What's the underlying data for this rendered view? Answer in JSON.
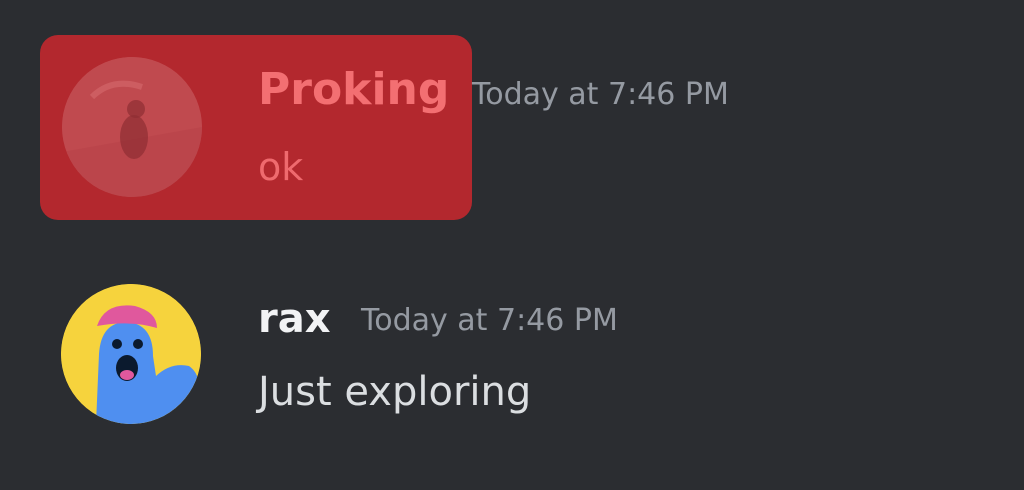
{
  "messages": [
    {
      "username": "Proking",
      "timestamp": "Today at 7:46 PM",
      "content": "ok",
      "highlighted": true,
      "avatar": "photo-avatar",
      "username_color": "#f36f72",
      "highlight_color": "#b3282e"
    },
    {
      "username": "rax",
      "timestamp": "Today at 7:46 PM",
      "content": "Just exploring",
      "highlighted": false,
      "avatar": "cartoon-blob-avatar",
      "username_color": "#f2f3f5",
      "avatar_background": "#f6d33d"
    }
  ],
  "colors": {
    "background": "#2b2d31",
    "timestamp": "#959aa2",
    "message_text": "#dbdee1"
  }
}
